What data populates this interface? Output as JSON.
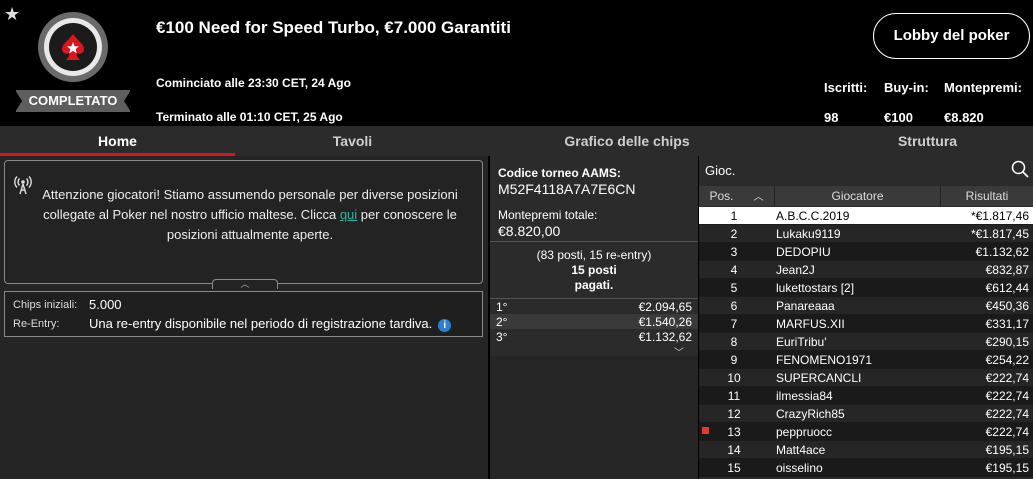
{
  "header": {
    "favorite_icon": "star-icon",
    "status_badge": "COMPLETATO",
    "title": "€100 Need for Speed Turbo, €7.000 Garantiti",
    "started": "Cominciato alle 23:30 CET, 24 Ago",
    "ended": "Terminato alle 01:10 CET, 25 Ago",
    "lobby_button": "Lobby del poker",
    "stats": {
      "entrants_label": "Iscritti:",
      "entrants_value": "98",
      "buyin_label": "Buy-in:",
      "buyin_value": "€100",
      "prizepool_label": "Montepremi:",
      "prizepool_value": "€8.820"
    }
  },
  "tabs": [
    {
      "label": "Home",
      "active": true
    },
    {
      "label": "Tavoli",
      "active": false
    },
    {
      "label": "Grafico delle chips",
      "active": false
    },
    {
      "label": "Struttura",
      "active": false
    }
  ],
  "notice": {
    "icon": "broadcast-icon",
    "text_before": "Attenzione giocatori! Stiamo assumendo personale per diverse posizioni collegate al Poker nel nostro ufficio maltese. Clicca ",
    "link": "qui",
    "text_after": " per conoscere le posizioni attualmente aperte.",
    "collapse_icon": "chevron-up-icon"
  },
  "info": {
    "chips_label": "Chips iniziali:",
    "chips_value": "5.000",
    "reentry_label": "Re-Entry:",
    "reentry_value": "Una re-entry disponibile nel periodo di registrazione tardiva.",
    "info_icon": "i"
  },
  "middle": {
    "code_label": "Codice torneo AAMS:",
    "code_value": "M52F4118A7A7E6CN",
    "prize_label": "Montepremi totale:",
    "prize_value": "€8.820,00",
    "paid_line1": "(83 posti, 15 re-entry)",
    "paid_line2": "15 posti",
    "paid_line3": "pagati.",
    "payouts": [
      {
        "place": "1°",
        "amount": "€2.094,65"
      },
      {
        "place": "2°",
        "amount": "€1.540,26"
      },
      {
        "place": "3°",
        "amount": "€1.132,62"
      }
    ],
    "expand_icon": "chevron-down-icon"
  },
  "players": {
    "search_placeholder": "Gioc.",
    "search_icon": "search-icon",
    "columns": {
      "pos": "Pos.",
      "player": "Giocatore",
      "results": "Risultati"
    },
    "sort_icon": "chevron-up-icon",
    "rows": [
      {
        "pos": "1",
        "name": "A.B.C.C.2019",
        "result": "*€1.817,46"
      },
      {
        "pos": "2",
        "name": "Lukaku9119",
        "result": "*€1.817,45"
      },
      {
        "pos": "3",
        "name": "DEDOPIU",
        "result": "€1.132,62"
      },
      {
        "pos": "4",
        "name": "Jean2J",
        "result": "€832,87"
      },
      {
        "pos": "5",
        "name": "lukettostars [2]",
        "result": "€612,44"
      },
      {
        "pos": "6",
        "name": "Panareaaa",
        "result": "€450,36"
      },
      {
        "pos": "7",
        "name": "MARFUS.XII",
        "result": "€331,17"
      },
      {
        "pos": "8",
        "name": "EuriTribu'",
        "result": "€290,15"
      },
      {
        "pos": "9",
        "name": "FENOMENO1971",
        "result": "€254,22"
      },
      {
        "pos": "10",
        "name": "SUPERCANCLI",
        "result": "€222,74"
      },
      {
        "pos": "11",
        "name": "ilmessia84",
        "result": "€222,74"
      },
      {
        "pos": "12",
        "name": "CrazyRich85",
        "result": "€222,74"
      },
      {
        "pos": "13",
        "name": "peppruocc",
        "result": "€222,74"
      },
      {
        "pos": "14",
        "name": "Matt4ace",
        "result": "€195,15"
      },
      {
        "pos": "15",
        "name": "oisselino",
        "result": "€195,15"
      }
    ]
  },
  "colors": {
    "accent": "#d9161c",
    "link": "#2bb5a1",
    "info": "#2f7fd1"
  }
}
